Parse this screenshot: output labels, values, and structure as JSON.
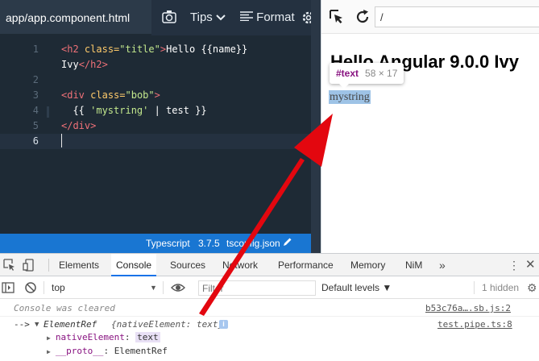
{
  "editor": {
    "file_tab": "app/app.component.html",
    "toolbar": {
      "tips": "Tips",
      "format": "Format"
    },
    "lines": [
      {
        "num": "1",
        "text": "<h2 class=\"title\">Hello {{name}}"
      },
      {
        "num": "",
        "text": "Ivy</h2>"
      },
      {
        "num": "2",
        "text": ""
      },
      {
        "num": "3",
        "text": "<div class=\"bob\">"
      },
      {
        "num": "4",
        "text": "  {{ 'mystring' | test }}"
      },
      {
        "num": "5",
        "text": "</div>"
      },
      {
        "num": "6",
        "text": ""
      }
    ],
    "active_line": "6",
    "status": {
      "language": "Typescript",
      "version": "3.7.5",
      "config": "tsconfig.json"
    }
  },
  "preview": {
    "url": "/",
    "heading": "Hello Angular 9.0.0 Ivy",
    "tooltip": {
      "node": "#text",
      "dims": "58 × 17"
    },
    "body_text": "mystring"
  },
  "devtools": {
    "tabs": [
      "Elements",
      "Console",
      "Sources",
      "Network",
      "Performance",
      "Memory",
      "NiM"
    ],
    "active_tab": "Console",
    "more": "»",
    "context": "top",
    "filter_placeholder": "Filter",
    "levels": "Default levels ▼",
    "hidden": "1 hidden",
    "console": {
      "cleared": "Console was cleared",
      "cleared_src": "b53c76a….sb.js:2",
      "log_prefix": "-->",
      "log_type": "ElementRef",
      "log_detail": "{nativeElement: text}",
      "log_src": "test.pipe.ts:8",
      "props": [
        {
          "key": "nativeElement",
          "value": "text"
        },
        {
          "key": "__proto__",
          "value": "ElementRef"
        }
      ]
    }
  },
  "colors": {
    "editor_bg": "#1e2a35",
    "status_bar": "#1976d2",
    "arrow": "#e3070f",
    "selection": "#9ec3e6",
    "active_tab_underline": "#1a73e8"
  }
}
